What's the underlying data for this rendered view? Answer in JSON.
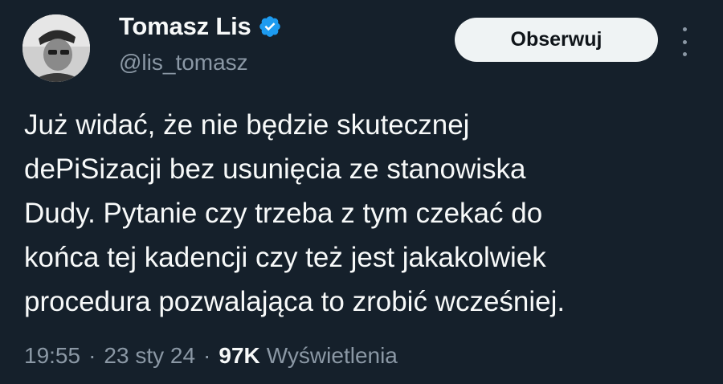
{
  "author": {
    "name": "Tomasz Lis",
    "handle": "@lis_tomasz",
    "verified": true,
    "verified_color": "#1d9bf0"
  },
  "actions": {
    "follow_label": "Obserwuj",
    "more_icon": "more-vertical-icon"
  },
  "tweet": {
    "lines": [
      "Już widać, że nie będzie skutecznej",
      "dePiSizacji bez usunięcia ze stanowiska",
      "Dudy. Pytanie czy trzeba z tym czekać do",
      "końca tej kadencji czy też jest jakakolwiek",
      "procedura pozwalająca to zrobić wcześniej."
    ]
  },
  "meta": {
    "time": "19:55",
    "separator": "·",
    "date": "23 sty 24",
    "views_count": "97K",
    "views_label": "Wyświetlenia"
  },
  "colors": {
    "background": "#15202b",
    "text": "#f7f9f9",
    "secondary_text": "#8b98a5",
    "button_bg": "#eff3f4"
  }
}
